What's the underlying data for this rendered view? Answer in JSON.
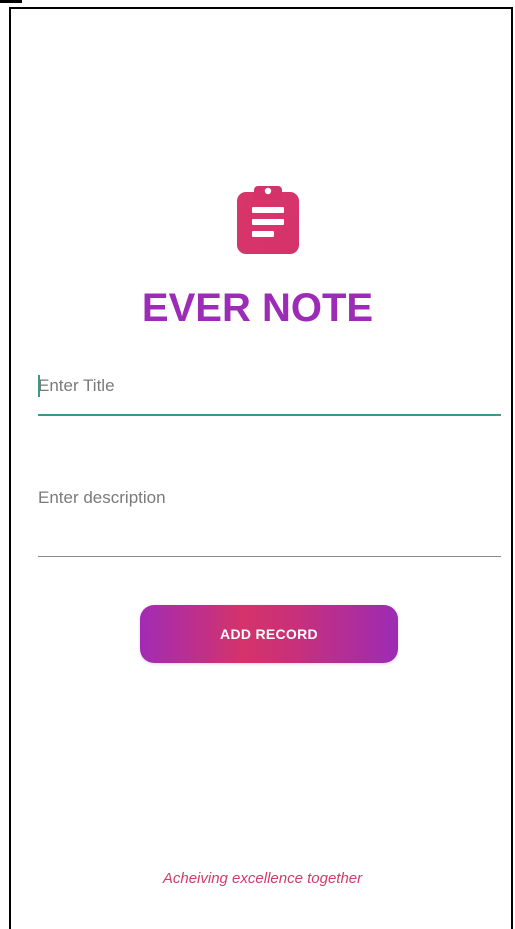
{
  "colors": {
    "brand_purple": "#9c2bb5",
    "brand_pink": "#d4336a",
    "title_field_focus": "#3a9a8a",
    "tagline": "#d23b6a"
  },
  "header": {
    "logo_icon": "clipboard-icon",
    "app_title": "EVER NOTE"
  },
  "form": {
    "title_placeholder": "Enter Title",
    "title_value": "",
    "description_placeholder": "Enter description",
    "description_value": "",
    "submit_label": "ADD RECORD"
  },
  "footer": {
    "tagline": "Acheiving excellence together"
  }
}
